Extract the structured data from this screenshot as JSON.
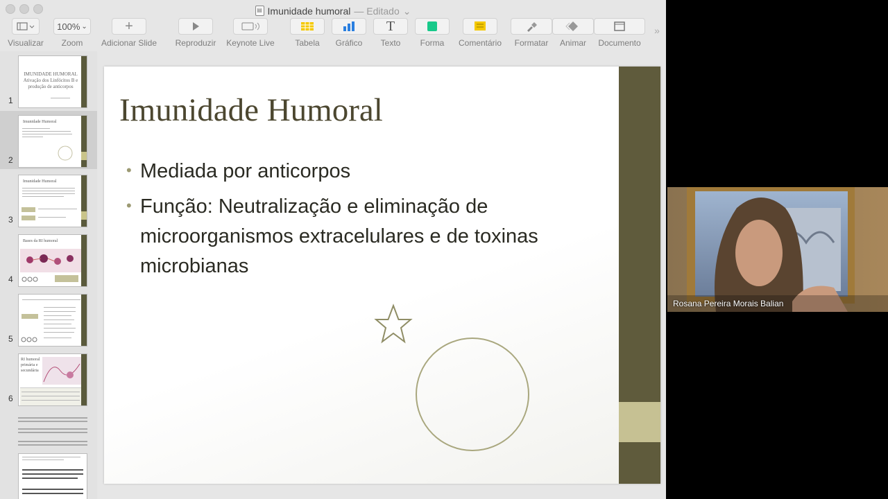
{
  "window": {
    "title": "Imunidade humoral",
    "status": "— Editado"
  },
  "toolbar": {
    "view": "Visualizar",
    "zoom_value": "100%",
    "zoom": "Zoom",
    "add_slide": "Adicionar Slide",
    "play": "Reproduzir",
    "keynote_live": "Keynote Live",
    "table": "Tabela",
    "chart": "Gráfico",
    "text": "Texto",
    "shape": "Forma",
    "comment": "Comentário",
    "format": "Formatar",
    "animate": "Animar",
    "document": "Documento",
    "more": "»"
  },
  "colors": {
    "table_icon": "#f4c800",
    "chart_icon": "#2a7fe0",
    "shape_icon": "#18c98a",
    "comment_icon": "#f4c800",
    "slide_bar": "#5f5b3c",
    "slide_accent": "#c6c193"
  },
  "sidebar": {
    "slides": [
      {
        "number": "1",
        "title": "IMUNIDADE HUMORAL Ativação dos Linfócitos B e produção de anticorpos"
      },
      {
        "number": "2",
        "title": "Imunidade Humoral"
      },
      {
        "number": "3",
        "title": "Imunidade Humoral"
      },
      {
        "number": "4",
        "title": "Bases da RI humoral"
      },
      {
        "number": "5",
        "title": ""
      },
      {
        "number": "6",
        "title": "RI humoral primária e secundária"
      }
    ]
  },
  "slide": {
    "title": "Imunidade Humoral",
    "bullets": [
      "Mediada por anticorpos",
      "Função: Neutralização e eliminação de microorganismos extracelulares e de toxinas microbianas"
    ]
  },
  "video": {
    "participant": "Rosana Pereira Morais Balian"
  }
}
